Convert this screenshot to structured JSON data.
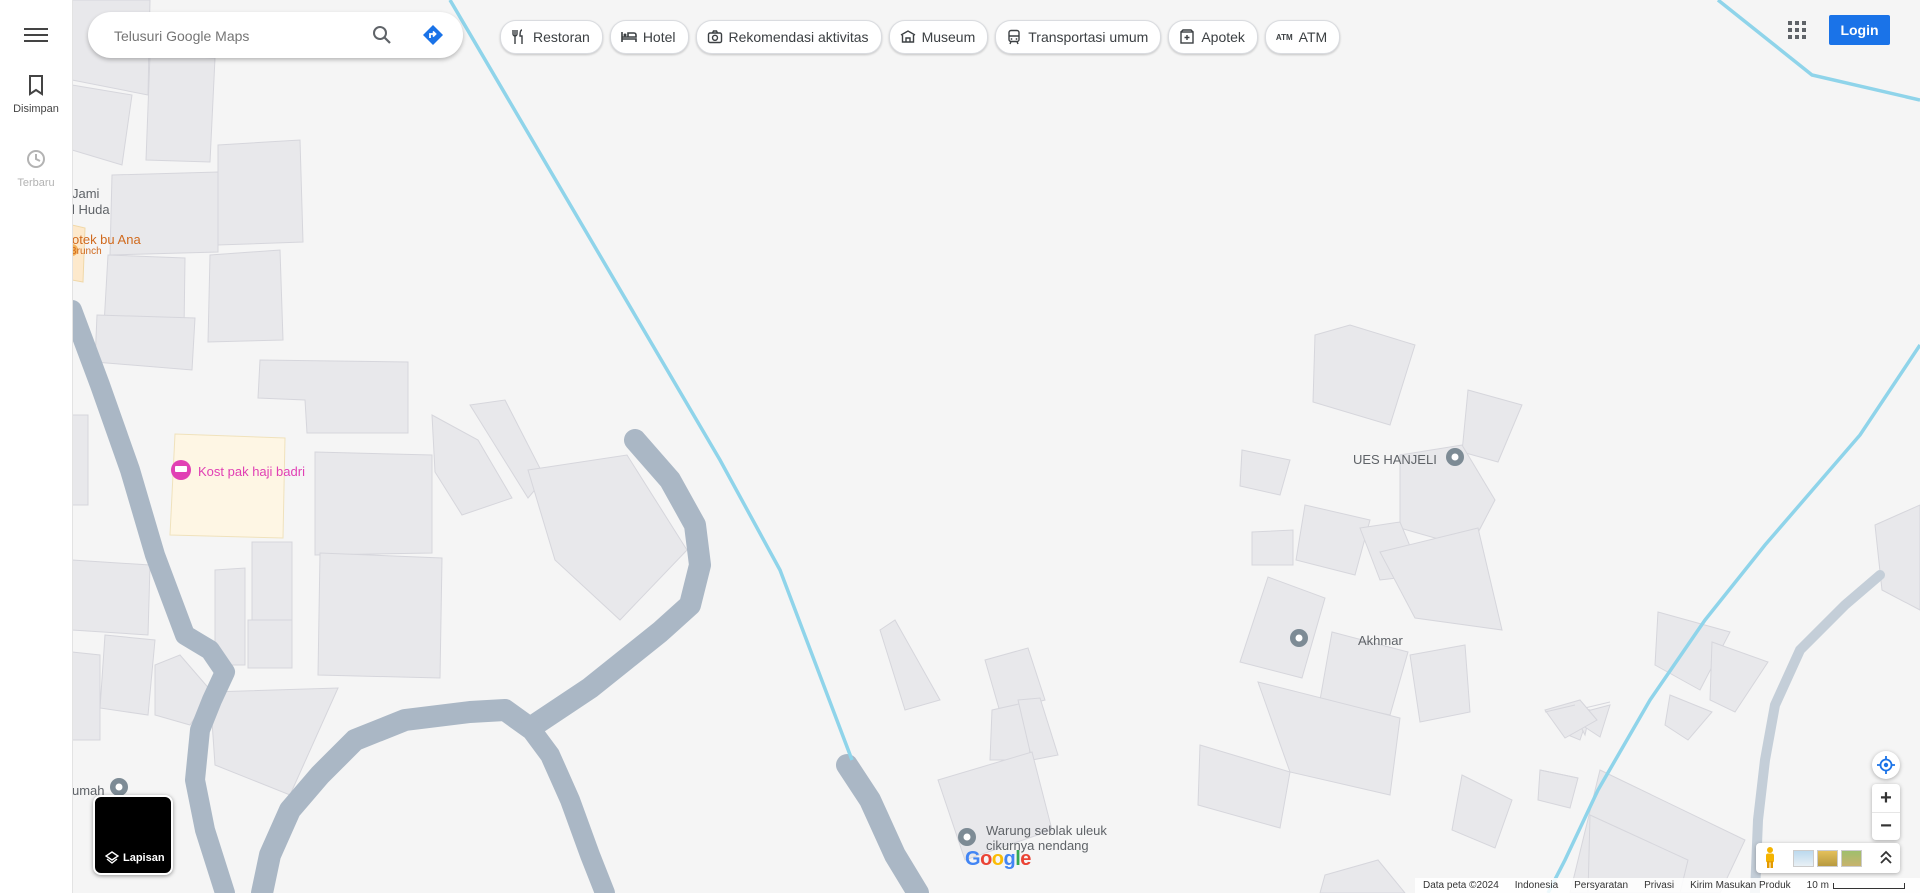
{
  "sidebar": {
    "saved_label": "Disimpan",
    "recent_label": "Terbaru"
  },
  "search": {
    "placeholder": "Telusuri Google Maps"
  },
  "chips": [
    {
      "label": "Restoran",
      "icon": "restaurant-icon"
    },
    {
      "label": "Hotel",
      "icon": "hotel-icon"
    },
    {
      "label": "Rekomendasi aktivitas",
      "icon": "camera-icon"
    },
    {
      "label": "Museum",
      "icon": "museum-icon"
    },
    {
      "label": "Transportasi umum",
      "icon": "transit-icon"
    },
    {
      "label": "Apotek",
      "icon": "pharmacy-icon"
    },
    {
      "label": "ATM",
      "icon": "atm-icon",
      "icon_text": "ATM"
    }
  ],
  "topbar": {
    "login_label": "Login",
    "apps_icon": "google-apps-icon"
  },
  "places": {
    "mosque_line1": "Jami",
    "mosque_line2": "l Huda",
    "shop_name": "otek bu Ana",
    "shop_category": "Brunch",
    "kost": "Kost pak haji badri",
    "rumah": "umah",
    "ues": "UES HANJELI",
    "akhmar": "Akhmar",
    "warung_line1": "Warung seblak uleuk",
    "warung_line2": "cikurnya nendang"
  },
  "layers": {
    "label": "Lapisan"
  },
  "footer": {
    "map_data": "Data peta ©2024",
    "country": "Indonesia",
    "terms": "Persyaratan",
    "privacy": "Privasi",
    "feedback": "Kirim Masukan Produk",
    "scale": "10 m"
  },
  "logo": {
    "text_letters": [
      "G",
      "o",
      "o",
      "g",
      "l",
      "e"
    ]
  },
  "colors": {
    "map_bg": "#f5f5f5",
    "building": "#e8e8eb",
    "road": "#aab7c5",
    "water": "#8fd4ea",
    "accent": "#1a73e8",
    "lodging": "#e140b4",
    "food": "#e07b28"
  }
}
